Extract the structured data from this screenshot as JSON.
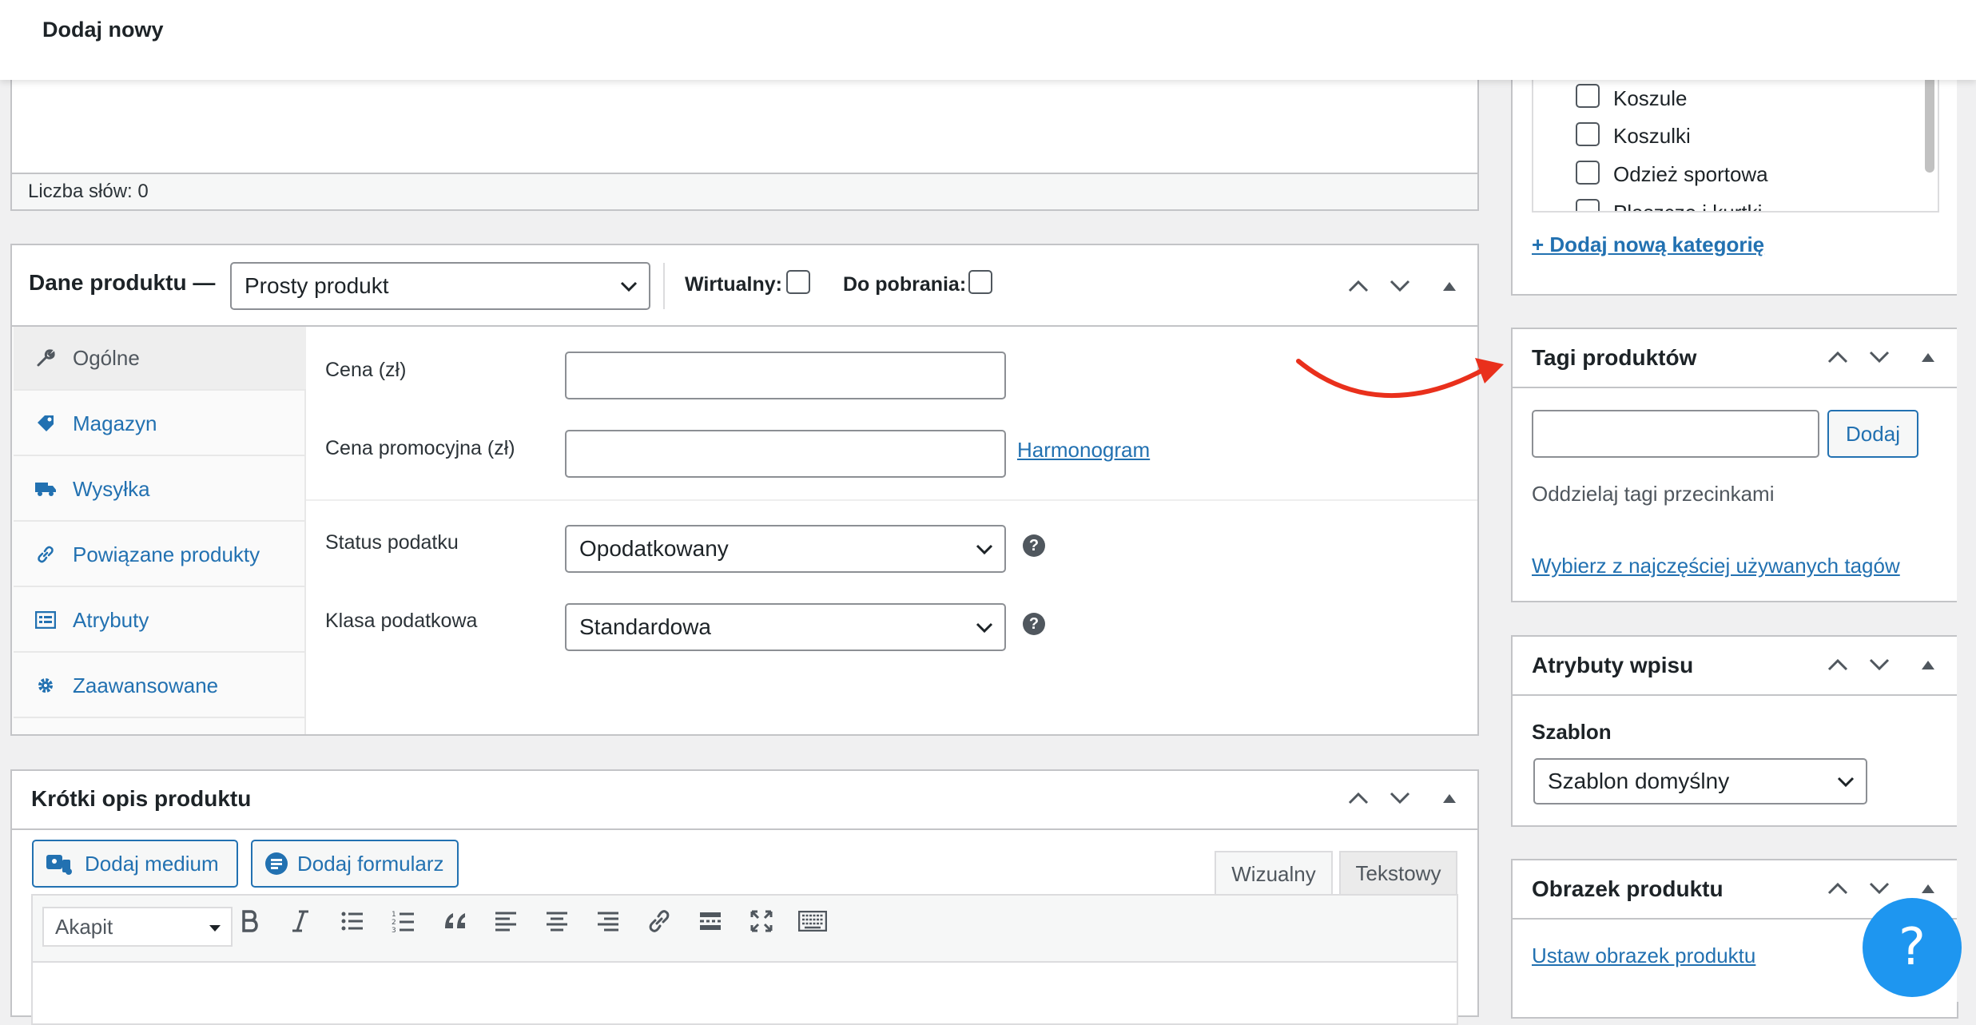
{
  "header": {
    "title": "Dodaj nowy"
  },
  "editor": {
    "word_count": "Liczba słów: 0"
  },
  "product_data": {
    "title": "Dane produktu —",
    "type": "Prosty produkt",
    "virtual_label": "Wirtualny:",
    "download_label": "Do pobrania:",
    "tabs": [
      {
        "label": "Ogólne",
        "icon": "wrench-icon"
      },
      {
        "label": "Magazyn",
        "icon": "tag-icon"
      },
      {
        "label": "Wysyłka",
        "icon": "truck-icon"
      },
      {
        "label": "Powiązane produkty",
        "icon": "link-icon"
      },
      {
        "label": "Atrybuty",
        "icon": "list-icon"
      },
      {
        "label": "Zaawansowane",
        "icon": "gear-icon"
      }
    ],
    "fields": {
      "price_label": "Cena (zł)",
      "price_value": "",
      "sale_price_label": "Cena promocyjna (zł)",
      "sale_price_value": "",
      "schedule_link": "Harmonogram",
      "tax_status_label": "Status podatku",
      "tax_status_value": "Opodatkowany",
      "tax_class_label": "Klasa podatkowa",
      "tax_class_value": "Standardowa"
    }
  },
  "short_description": {
    "title": "Krótki opis produktu",
    "add_media": "Dodaj medium",
    "add_form": "Dodaj formularz",
    "tab_visual": "Wizualny",
    "tab_text": "Tekstowy",
    "format_select": "Akapit"
  },
  "categories": {
    "items": [
      "Koszule",
      "Koszulki",
      "Odzież sportowa",
      "Płaszcze i kurtki"
    ],
    "add_link": "+ Dodaj nową kategorię"
  },
  "tags": {
    "title": "Tagi produktów",
    "input_value": "",
    "add_button": "Dodaj",
    "hint": "Oddzielaj tagi przecinkami",
    "popular_link": "Wybierz z najczęściej używanych tagów"
  },
  "post_attributes": {
    "title": "Atrybuty wpisu",
    "template_label": "Szablon",
    "template_value": "Szablon domyślny"
  },
  "product_image": {
    "title": "Obrazek produktu",
    "set_link": "Ustaw obrazek produktu"
  },
  "help": {
    "label": "?"
  },
  "colors": {
    "accent": "#2271b1",
    "arrow": "#e9301c",
    "help": "#1e96f0",
    "border": "#c3c4c7"
  }
}
